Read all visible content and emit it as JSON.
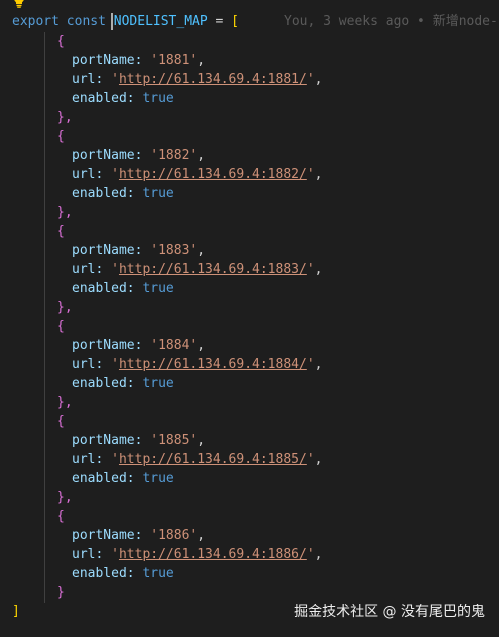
{
  "editor": {
    "line1": {
      "keyword_export": "export",
      "keyword_const": "const",
      "identifier": "NODELIST_MAP",
      "equals": "=",
      "open_bracket": "["
    },
    "blame": "You, 3 weeks ago • 新增node-",
    "closing_bracket": "]",
    "entries": [
      {
        "open": "{",
        "port_key": "portName:",
        "port_value": "'1881'",
        "url_key": "url:",
        "url_value": "http://61.134.69.4:1881/",
        "enabled_key": "enabled:",
        "enabled_value": "true",
        "close": "},"
      },
      {
        "open": "{",
        "port_key": "portName:",
        "port_value": "'1882'",
        "url_key": "url:",
        "url_value": "http://61.134.69.4:1882/",
        "enabled_key": "enabled:",
        "enabled_value": "true",
        "close": "},"
      },
      {
        "open": "{",
        "port_key": "portName:",
        "port_value": "'1883'",
        "url_key": "url:",
        "url_value": "http://61.134.69.4:1883/",
        "enabled_key": "enabled:",
        "enabled_value": "true",
        "close": "},"
      },
      {
        "open": "{",
        "port_key": "portName:",
        "port_value": "'1884'",
        "url_key": "url:",
        "url_value": "http://61.134.69.4:1884/",
        "enabled_key": "enabled:",
        "enabled_value": "true",
        "close": "},"
      },
      {
        "open": "{",
        "port_key": "portName:",
        "port_value": "'1885'",
        "url_key": "url:",
        "url_value": "http://61.134.69.4:1885/",
        "enabled_key": "enabled:",
        "enabled_value": "true",
        "close": "},"
      },
      {
        "open": "{",
        "port_key": "portName:",
        "port_value": "'1886'",
        "url_key": "url:",
        "url_value": "http://61.134.69.4:1886/",
        "enabled_key": "enabled:",
        "enabled_value": "true",
        "close": "}"
      }
    ]
  },
  "watermark": "掘金技术社区 @ 没有尾巴的鬼",
  "colors": {
    "background": "#1e1e1e",
    "keyword": "#569cd6",
    "constant": "#4fc1ff",
    "property": "#9cdcfe",
    "string": "#ce9178",
    "bracket_gold": "#ffd700",
    "bracket_purple": "#da70d6"
  },
  "icons": {
    "lightbulb": "lightbulb-icon"
  }
}
